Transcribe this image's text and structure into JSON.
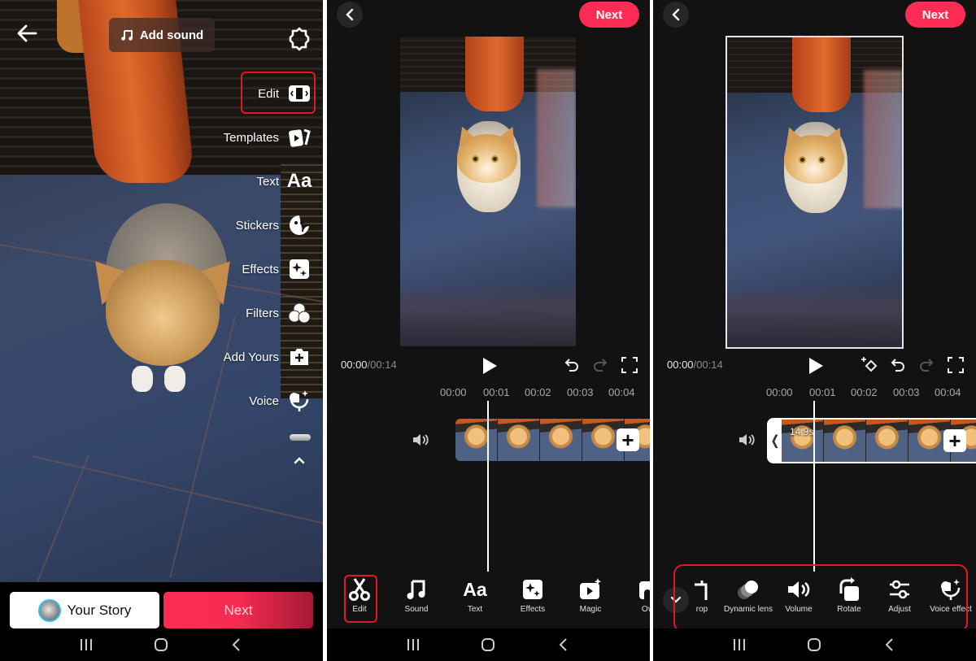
{
  "panel1": {
    "top_bar": {
      "back_icon": "arrow-left-icon",
      "add_sound_label": "Add sound",
      "settings_icon": "gear-icon"
    },
    "side_tools": [
      {
        "label": "Edit",
        "icon": "edit-clip-icon",
        "highlighted": true
      },
      {
        "label": "Templates",
        "icon": "templates-icon"
      },
      {
        "label": "Text",
        "icon": "text-aa-icon"
      },
      {
        "label": "Stickers",
        "icon": "sticker-icon"
      },
      {
        "label": "Effects",
        "icon": "sparkle-effects-icon"
      },
      {
        "label": "Filters",
        "icon": "filters-icon"
      },
      {
        "label": "Add Yours",
        "icon": "add-yours-icon"
      },
      {
        "label": "Voice",
        "icon": "voice-icon"
      }
    ],
    "bottom": {
      "story_label": "Your Story",
      "next_label": "Next"
    }
  },
  "panel2": {
    "back_icon": "chevron-left-icon",
    "next_label": "Next",
    "time_current": "00:00",
    "time_separator": "/",
    "time_total": "00:14",
    "ruler_ticks": [
      "00:00",
      "00:01",
      "00:02",
      "00:03",
      "00:04"
    ],
    "tools": [
      {
        "label": "Edit",
        "icon": "scissors-icon",
        "highlighted": true
      },
      {
        "label": "Sound",
        "icon": "music-note-icon"
      },
      {
        "label": "Text",
        "icon": "text-aa-icon"
      },
      {
        "label": "Effects",
        "icon": "sparkle-effects-icon"
      },
      {
        "label": "Magic",
        "icon": "magic-icon"
      },
      {
        "label": "Ove",
        "icon": "overlay-icon"
      }
    ]
  },
  "panel3": {
    "back_icon": "chevron-left-icon",
    "next_label": "Next",
    "time_current": "00:00",
    "time_separator": "/",
    "time_total": "00:14",
    "ruler_ticks": [
      "00:00",
      "00:01",
      "00:02",
      "00:03",
      "00:04"
    ],
    "clip_duration": "14.9s",
    "tools": [
      {
        "label": "rop",
        "icon": "crop-icon"
      },
      {
        "label": "Dynamic lens",
        "icon": "dynamic-lens-icon"
      },
      {
        "label": "Volume",
        "icon": "volume-icon"
      },
      {
        "label": "Rotate",
        "icon": "rotate-icon"
      },
      {
        "label": "Adjust",
        "icon": "adjust-sliders-icon"
      },
      {
        "label": "Voice effect",
        "icon": "voice-effect-icon"
      }
    ]
  },
  "colors": {
    "accent": "#fe2c55",
    "highlight": "#e01a22",
    "editor_bg": "#121212",
    "story_ring": "#29c6e6"
  }
}
